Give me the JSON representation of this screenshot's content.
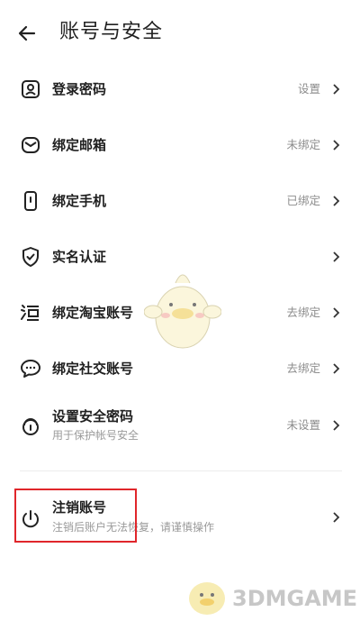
{
  "header": {
    "title": "账号与安全"
  },
  "rows": [
    {
      "label": "登录密码",
      "value": "设置"
    },
    {
      "label": "绑定邮箱",
      "value": "未绑定"
    },
    {
      "label": "绑定手机",
      "value": "已绑定"
    },
    {
      "label": "实名认证",
      "value": ""
    },
    {
      "label": "绑定淘宝账号",
      "value": "去绑定"
    },
    {
      "label": "绑定社交账号",
      "value": "去绑定"
    },
    {
      "label": "设置安全密码",
      "value": "未设置",
      "sub": "用于保护帐号安全"
    }
  ],
  "cancel": {
    "label": "注销账号",
    "sub": "注销后账户无法恢复，请谨慎操作"
  },
  "watermark": {
    "text": "3DMGAME"
  },
  "colors": {
    "highlight": "#e0262b",
    "secondary_text": "#8c8c8c"
  },
  "icons": [
    "back-arrow-icon",
    "user-lock-icon",
    "envelope-icon",
    "phone-icon",
    "shield-check-icon",
    "taobao-icon",
    "chat-icon",
    "lock-icon",
    "power-icon",
    "chevron-right-icon"
  ]
}
